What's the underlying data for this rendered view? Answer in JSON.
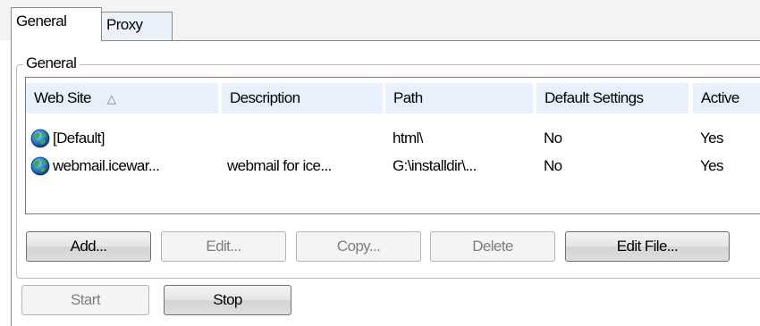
{
  "tabs": [
    {
      "label": "General",
      "selected": true
    },
    {
      "label": "Proxy",
      "selected": false
    }
  ],
  "group": {
    "legend": "General"
  },
  "list": {
    "columns": [
      "Web Site",
      "Description",
      "Path",
      "Default Settings",
      "Active"
    ],
    "sort_indicator": "△",
    "rows": [
      {
        "site": "[Default]",
        "description": "",
        "path": "html\\",
        "default": "No",
        "active": "Yes",
        "icon": "globe-icon"
      },
      {
        "site": "webmail.icewar...",
        "description": "webmail for ice...",
        "path": "G:\\installdir\\...",
        "default": "No",
        "active": "Yes",
        "icon": "globe-icon"
      }
    ]
  },
  "buttons": {
    "add": "Add...",
    "edit": "Edit...",
    "copy": "Copy...",
    "delete": "Delete",
    "edit_file": "Edit File...",
    "start": "Start",
    "stop": "Stop"
  },
  "colors": {
    "header_bg": "#e8f1fb",
    "border": "#7a7a7a",
    "disabled_text": "#7f7f7f"
  }
}
